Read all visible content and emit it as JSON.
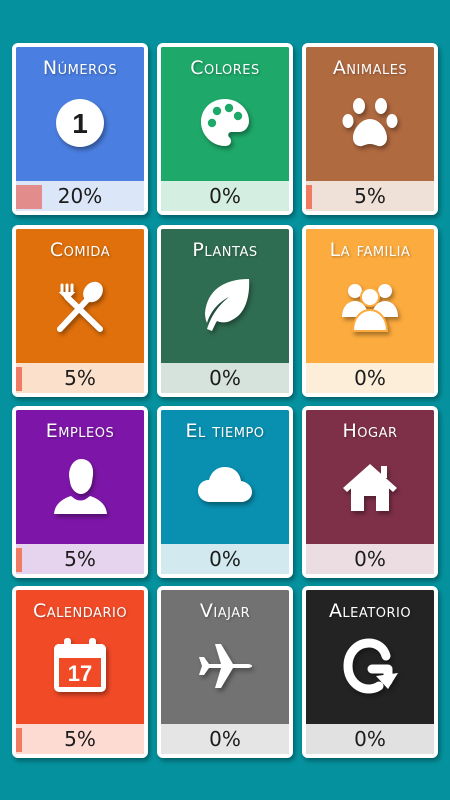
{
  "categories": [
    {
      "title": "Números",
      "icon": "number-one-icon",
      "color": "#4a7ee0",
      "bar_bg": "#dbe6f8",
      "fill_color": "#e38c8c",
      "progress": 20,
      "percent_label": "20%"
    },
    {
      "title": "Colores",
      "icon": "palette-icon",
      "color": "#1ea869",
      "bar_bg": "#d5eee2",
      "fill_color": "#f17a62",
      "progress": 0,
      "percent_label": "0%"
    },
    {
      "title": "Animales",
      "icon": "paw-icon",
      "color": "#b06a40",
      "bar_bg": "#f0e1d8",
      "fill_color": "#f17a62",
      "progress": 5,
      "percent_label": "5%"
    },
    {
      "title": "Comida",
      "icon": "fork-spoon-icon",
      "color": "#e0700b",
      "bar_bg": "#fbe1cc",
      "fill_color": "#f17a62",
      "progress": 5,
      "percent_label": "5%"
    },
    {
      "title": "Plantas",
      "icon": "leaf-icon",
      "color": "#2f6d52",
      "bar_bg": "#d6e2dc",
      "fill_color": "#f17a62",
      "progress": 0,
      "percent_label": "0%"
    },
    {
      "title": "La familia",
      "icon": "family-icon",
      "color": "#fcab3e",
      "bar_bg": "#fdeed9",
      "fill_color": "#f17a62",
      "progress": 0,
      "percent_label": "0%"
    },
    {
      "title": "Empleos",
      "icon": "person-icon",
      "color": "#7d16a8",
      "bar_bg": "#e6d3ee",
      "fill_color": "#f17a62",
      "progress": 5,
      "percent_label": "5%"
    },
    {
      "title": "El tiempo",
      "icon": "cloud-icon",
      "color": "#098fb0",
      "bar_bg": "#d2e9f0",
      "fill_color": "#f17a62",
      "progress": 0,
      "percent_label": "0%"
    },
    {
      "title": "Hogar",
      "icon": "house-icon",
      "color": "#7f3049",
      "bar_bg": "#ecdde2",
      "fill_color": "#f17a62",
      "progress": 0,
      "percent_label": "0%"
    },
    {
      "title": "Calendario",
      "icon": "calendar-icon",
      "color": "#f14a27",
      "bar_bg": "#fddbd3",
      "fill_color": "#f17a62",
      "progress": 5,
      "percent_label": "5%",
      "calendar_day": "17"
    },
    {
      "title": "Viajar",
      "icon": "airplane-icon",
      "color": "#727272",
      "bar_bg": "#e5e5e5",
      "fill_color": "#f17a62",
      "progress": 0,
      "percent_label": "0%"
    },
    {
      "title": "Aleatorio",
      "icon": "random-icon",
      "color": "#232323",
      "bar_bg": "#e1e1e1",
      "fill_color": "#f17a62",
      "progress": 0,
      "percent_label": "0%",
      "icon_letter": "G"
    }
  ]
}
